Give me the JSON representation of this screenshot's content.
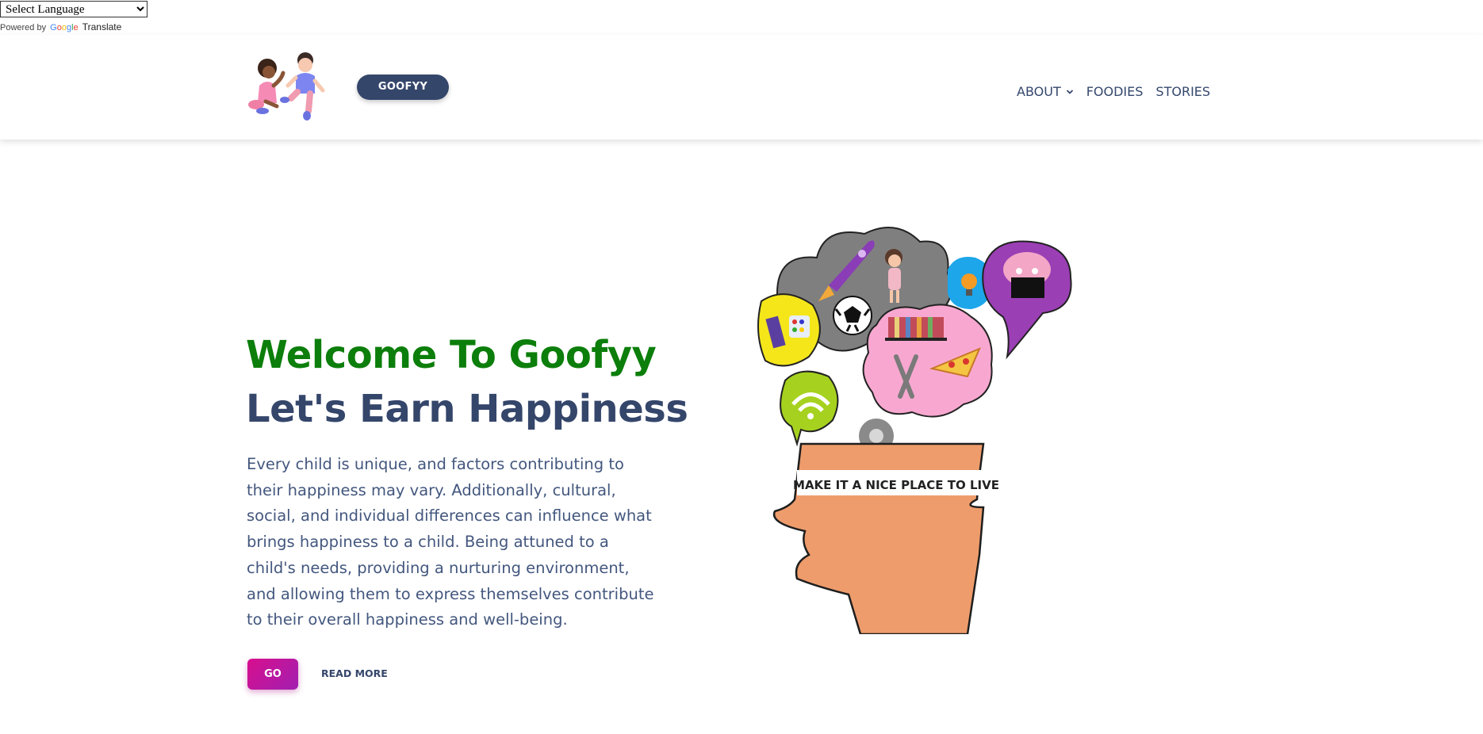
{
  "translate": {
    "select_label": "Select Language",
    "powered_by": "Powered by",
    "google": "Google",
    "translate": "Translate"
  },
  "header": {
    "brand_button": "GOOFYY",
    "nav": [
      {
        "label": "ABOUT",
        "has_dropdown": true
      },
      {
        "label": "FOODIES"
      },
      {
        "label": "STORIES"
      }
    ]
  },
  "hero": {
    "title_line1": "Welcome To Goofyy",
    "title_line2": "Let's Earn Happiness",
    "body": "Every child is unique, and factors contributing to their happiness may vary. Additionally, cultural, social, and individual differences can influence what brings happiness to a child. Being attuned to a child's needs, providing a nurturing environment, and allowing them to express themselves contribute to their overall happiness and well-being.",
    "go_button": "GO",
    "read_more": "READ MORE",
    "image_caption": "MAKE IT A NICE PLACE TO LIVE"
  },
  "colors": {
    "brand_navy": "#35466b",
    "title_green": "#0c7e0b",
    "go_gradient_start": "#d80f8e",
    "go_gradient_end": "#a11fb0",
    "head_skin": "#ee9c6c"
  }
}
